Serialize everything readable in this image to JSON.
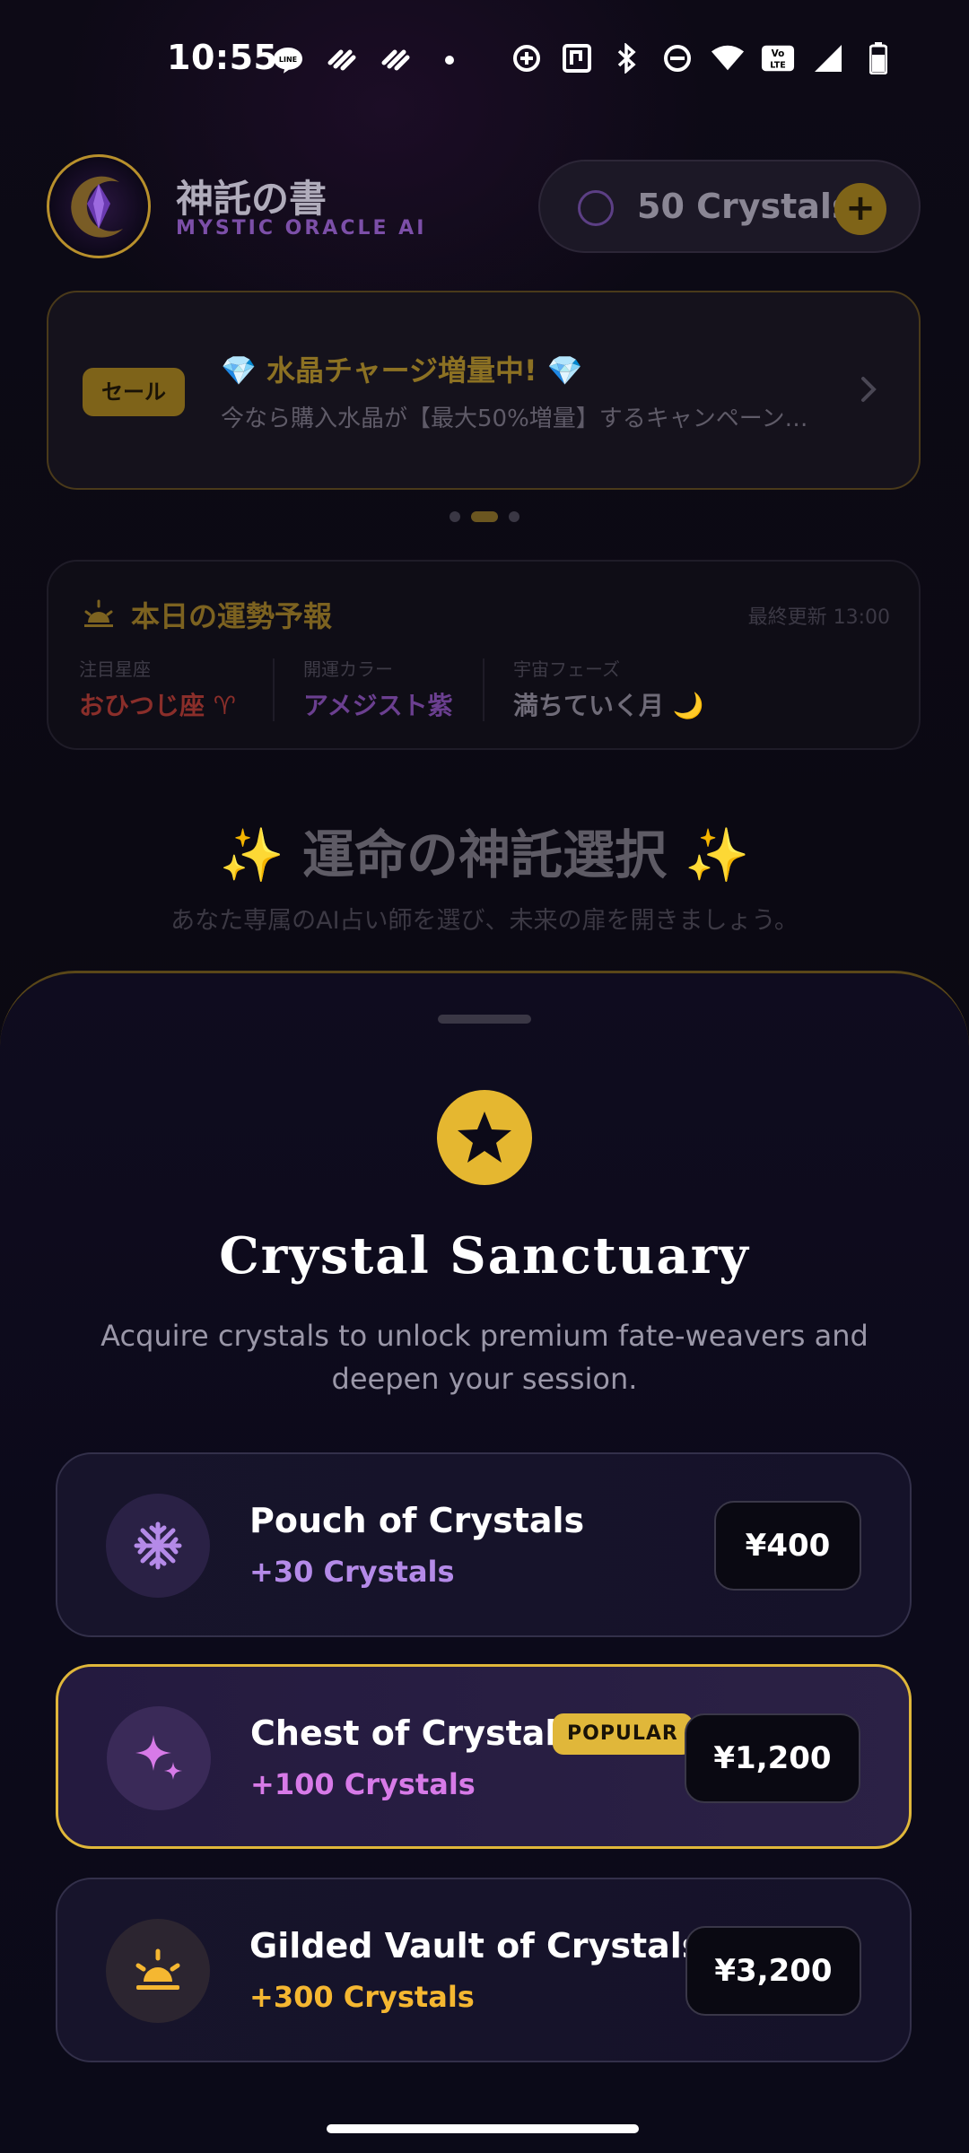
{
  "status_bar": {
    "time": "10:55",
    "notification_icons": [
      "line-icon",
      "app-notification-icon",
      "app-notification-icon",
      "dot-icon"
    ],
    "system_icons": [
      "data-saver-icon",
      "nfc-icon",
      "bluetooth-icon",
      "do-not-disturb-icon",
      "wifi-icon",
      "volte-icon",
      "signal-icon",
      "battery-icon"
    ]
  },
  "header": {
    "brand_title": "神託の書",
    "brand_subtitle": "MYSTIC ORACLE AI",
    "crystals_label": "50 Crystals",
    "add_label": "+"
  },
  "banner": {
    "badge": "セール",
    "title": "💎 水晶チャージ増量中! 💎",
    "description": "今なら購入水晶が【最大50%増量】するキャンペーン…",
    "page_count": 3,
    "active_page": 2
  },
  "fortune": {
    "title": "本日の運勢予報",
    "updated": "最終更新 13:00",
    "items": [
      {
        "label": "注目星座",
        "value": "おひつじ座 ♈",
        "color": "#8a2e2a"
      },
      {
        "label": "開運カラー",
        "value": "アメジスト紫",
        "color": "#6b3f90"
      },
      {
        "label": "宇宙フェーズ",
        "value": "満ちていく月 🌙",
        "color": "#6f6b78"
      }
    ]
  },
  "oracle": {
    "title": "✨ 運命の神託選択 ✨",
    "subtitle": "あなた専属のAI占い師を選び、未来の扉を開きましょう。"
  },
  "sheet": {
    "title": "Crystal Sanctuary",
    "subtitle": "Acquire crystals to unlock premium fate-weavers and deepen your session.",
    "packs": [
      {
        "name": "Pouch of Crystals",
        "amount": "+30 Crystals",
        "price": "¥400",
        "badge": "",
        "icon": "snowflake-icon",
        "accent": "#b48ae8",
        "icon_bg": "#2a2145"
      },
      {
        "name": "Chest of Crystals",
        "amount": "+100 Crystals",
        "price": "¥1,200",
        "badge": "POPULAR",
        "icon": "sparkles-icon",
        "accent": "#d77ae8",
        "icon_bg": "#3a2a58"
      },
      {
        "name": "Gilded Vault of Crystals",
        "amount": "+300 Crystals",
        "price": "¥3,200",
        "badge": "",
        "icon": "sunrise-icon",
        "accent": "#f5b731",
        "icon_bg": "#2c2530"
      }
    ]
  }
}
